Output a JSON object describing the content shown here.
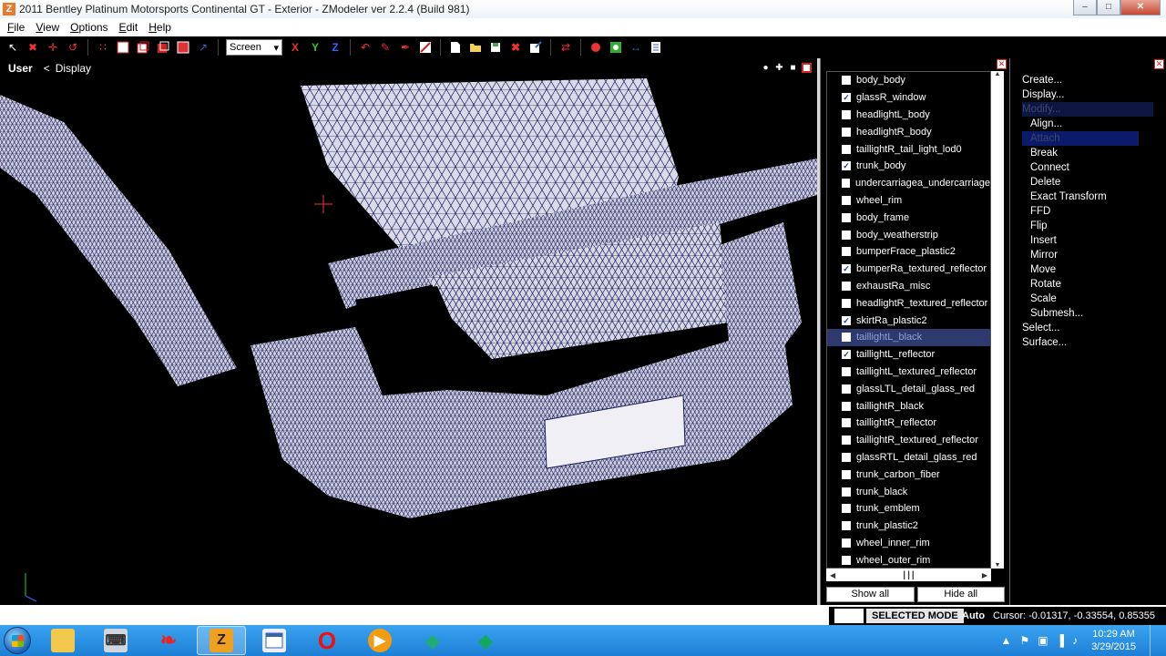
{
  "window": {
    "app_icon": "Z",
    "title": "2011 Bentley Platinum Motorsports Continental GT - Exterior - ZModeler ver 2.2.4 (Build 981)",
    "min": "–",
    "max": "□",
    "close": "✕"
  },
  "menu": {
    "file": "File",
    "view": "View",
    "options": "Options",
    "edit": "Edit",
    "help": "Help"
  },
  "toolbar": {
    "screen_value": "Screen",
    "screen_arrow": "▾",
    "axis_x": "X",
    "axis_y": "Y",
    "axis_z": "Z"
  },
  "viewport": {
    "view_name": "User",
    "back_arrow": "<",
    "display_label": "Display"
  },
  "object_list": {
    "items": [
      {
        "label": "body_body",
        "checked": false
      },
      {
        "label": "glassR_window",
        "checked": true
      },
      {
        "label": "headlightL_body",
        "checked": false
      },
      {
        "label": "headlightR_body",
        "checked": false
      },
      {
        "label": "taillightR_tail_light_lod0",
        "checked": false
      },
      {
        "label": "trunk_body",
        "checked": true
      },
      {
        "label": "undercarriagea_undercarriage",
        "checked": false
      },
      {
        "label": "wheel_rim",
        "checked": false
      },
      {
        "label": "body_frame",
        "checked": false
      },
      {
        "label": "body_weatherstrip",
        "checked": false
      },
      {
        "label": "bumperFrace_plastic2",
        "checked": false
      },
      {
        "label": "bumperRa_textured_reflector",
        "checked": true
      },
      {
        "label": "exhaustRa_misc",
        "checked": false
      },
      {
        "label": "headlightR_textured_reflector",
        "checked": false
      },
      {
        "label": "skirtRa_plastic2",
        "checked": true
      },
      {
        "label": "taillightL_black",
        "checked": false,
        "selected": true
      },
      {
        "label": "taillightL_reflector",
        "checked": true
      },
      {
        "label": "taillightL_textured_reflector",
        "checked": false
      },
      {
        "label": "glassLTL_detail_glass_red",
        "checked": false
      },
      {
        "label": "taillightR_black",
        "checked": false
      },
      {
        "label": "taillightR_reflector",
        "checked": false
      },
      {
        "label": "taillightR_textured_reflector",
        "checked": false
      },
      {
        "label": "glassRTL_detail_glass_red",
        "checked": false
      },
      {
        "label": "trunk_carbon_fiber",
        "checked": false
      },
      {
        "label": "trunk_black",
        "checked": false
      },
      {
        "label": "trunk_emblem",
        "checked": false
      },
      {
        "label": "trunk_plastic2",
        "checked": false
      },
      {
        "label": "wheel_inner_rim",
        "checked": false
      },
      {
        "label": "wheel_outer_rim",
        "checked": false
      }
    ],
    "check_mark": "✓",
    "show_all": "Show all",
    "hide_all": "Hide all"
  },
  "commands": [
    {
      "label": "Create...",
      "sub": false
    },
    {
      "label": "Display...",
      "sub": false
    },
    {
      "label": "Modify...",
      "sub": false,
      "disabled": true
    },
    {
      "label": "Align...",
      "sub": true
    },
    {
      "label": "Attach",
      "sub": true,
      "disabled": true
    },
    {
      "label": "Break",
      "sub": true
    },
    {
      "label": "Connect",
      "sub": true
    },
    {
      "label": "Delete",
      "sub": true
    },
    {
      "label": "Exact Transform",
      "sub": true
    },
    {
      "label": "FFD",
      "sub": true
    },
    {
      "label": "Flip",
      "sub": true
    },
    {
      "label": "Insert",
      "sub": true
    },
    {
      "label": "Mirror",
      "sub": true
    },
    {
      "label": "Move",
      "sub": true
    },
    {
      "label": "Rotate",
      "sub": true
    },
    {
      "label": "Scale",
      "sub": true
    },
    {
      "label": "Submesh...",
      "sub": true
    },
    {
      "label": "Select...",
      "sub": false
    },
    {
      "label": "Surface...",
      "sub": false
    }
  ],
  "status": {
    "mode": "SELECTED MODE",
    "auto": "Auto",
    "cursor": "Cursor: -0.01317, -0.33554, 0.85355"
  },
  "taskbar": {
    "time": "10:29 AM",
    "date": "3/29/2015",
    "zmodeler_glyph": "Z",
    "opera_glyph": "O"
  },
  "colors": {
    "wire": "#1a1f5c",
    "surface": "#d9d9e6",
    "selection": "#2e3a6e",
    "taskbar": "#2a8fe6"
  }
}
